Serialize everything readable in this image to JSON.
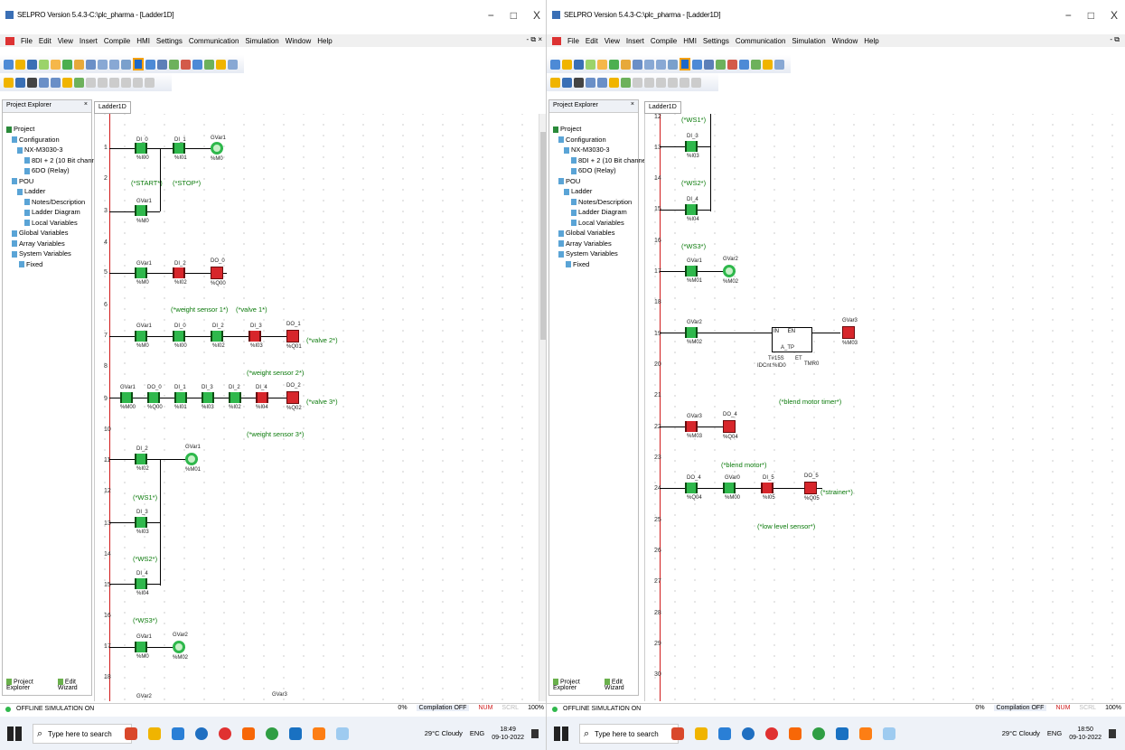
{
  "left": {
    "title": "SELPRO Version 5.4.3-C:\\plc_pharma - [Ladder1D]",
    "window_controls": [
      "−",
      "□",
      "X"
    ],
    "menu": [
      "File",
      "Edit",
      "View",
      "Insert",
      "Compile",
      "HMI",
      "Settings",
      "Communication",
      "Simulation",
      "Window",
      "Help"
    ],
    "mdi_controls": "- ⧉ ×",
    "explorer_title": "Project Explorer",
    "explorer_close": "×",
    "tree": [
      "Project",
      "Configuration",
      "NX-M3030-3",
      "8DI + 2 (10 Bit channel)",
      "6DO (Relay)",
      "POU",
      "Ladder",
      "Notes/Description",
      "Ladder Diagram",
      "Local Variables",
      "Global Variables",
      "Array Variables",
      "System Variables",
      "Fixed"
    ],
    "explorer_tabs": [
      "Project Explorer",
      "Edit Wizard"
    ],
    "doc_tab": "Ladder1D",
    "rungs": [
      "1",
      "2",
      "3",
      "4",
      "5",
      "6",
      "7",
      "8",
      "9",
      "10",
      "11",
      "12",
      "13",
      "14",
      "15",
      "16",
      "17",
      "18"
    ],
    "comments": {
      "start": "(*START*)",
      "stop": "(*STOP*)",
      "ws1_label": "(*weight sensor 1*)",
      "valve1": "(*valve 1*)",
      "valve2": "(*valve 2*)",
      "ws2_label": "(*weight sensor 2*)",
      "valve3": "(*valve 3*)",
      "ws3_label": "(*weight sensor 3*)",
      "ws1": "(*WS1*)",
      "ws2": "(*WS2*)",
      "ws3": "(*WS3*)"
    },
    "contacts": {
      "r1": [
        [
          "DI_0",
          "%I00"
        ],
        [
          "DI_1",
          "%I01"
        ]
      ],
      "r1coil": [
        "GVar1",
        "%M0"
      ],
      "r3": [
        "GVar1",
        "%M0"
      ],
      "r5": [
        [
          "GVar1",
          "%M0"
        ],
        [
          "DI_2",
          "%I02"
        ]
      ],
      "r5coil": [
        "DO_0",
        "%Q00"
      ],
      "r7": [
        [
          "GVar1",
          "%M0"
        ],
        [
          "DI_0",
          "%I00"
        ],
        [
          "DI_2",
          "%I02"
        ],
        [
          "DI_3",
          "%I03"
        ]
      ],
      "r7coil": [
        "DO_1",
        "%Q01"
      ],
      "r9": [
        [
          "GVar1",
          "%M00"
        ],
        [
          "DO_0",
          "%Q00"
        ],
        [
          "DI_1",
          "%I01"
        ],
        [
          "DI_3",
          "%I03"
        ],
        [
          "DI_2",
          "%I02"
        ],
        [
          "DI_4",
          "%I04"
        ]
      ],
      "r9coil": [
        "DO_2",
        "%Q02"
      ],
      "r11": [
        "DI_2",
        "%I02"
      ],
      "r11coil": [
        "GVar1",
        "%M01"
      ],
      "r13": [
        "DI_3",
        "%I03"
      ],
      "r15": [
        "DI_4",
        "%I04"
      ],
      "r17": [
        "GVar1",
        "%M0"
      ],
      "r17coil": [
        "GVar2",
        "%M02"
      ],
      "r19a": "GVar2",
      "r19b": "GVar3"
    },
    "status": {
      "mode": "OFFLINE SIMULATION ON",
      "pct": "0%",
      "compilation": "Compilation OFF",
      "num": "NUM",
      "scrl": "SCRL",
      "zoom": "100%"
    },
    "search_placeholder": "Type here to search",
    "weather": "29°C Cloudy",
    "lang": "ENG",
    "time": "18:49",
    "date": "09-10-2022"
  },
  "right": {
    "title": "SELPRO Version 5.4.3-C:\\plc_pharma - [Ladder1D]",
    "window_controls": [
      "−",
      "□",
      "X"
    ],
    "menu": [
      "File",
      "Edit",
      "View",
      "Insert",
      "Compile",
      "HMI",
      "Settings",
      "Communication",
      "Simulation",
      "Window",
      "Help"
    ],
    "mdi_controls": "- ⧉",
    "explorer_title": "Project Explorer",
    "explorer_close": "×",
    "tree": [
      "Project",
      "Configuration",
      "NX-M3030-3",
      "8DI + 2 (10 Bit channel)",
      "6DO (Relay)",
      "POU",
      "Ladder",
      "Notes/Description",
      "Ladder Diagram",
      "Local Variables",
      "Global Variables",
      "Array Variables",
      "System Variables",
      "Fixed"
    ],
    "explorer_tabs": [
      "Project Explorer",
      "Edit Wizard"
    ],
    "doc_tab": "Ladder1D",
    "rungs": [
      "12",
      "13",
      "14",
      "15",
      "16",
      "17",
      "18",
      "19",
      "20",
      "21",
      "22",
      "23",
      "24",
      "25",
      "26",
      "27",
      "28",
      "29",
      "30"
    ],
    "comments": {
      "ws1": "(*WS1*)",
      "ws2": "(*WS2*)",
      "ws3": "(*WS3*)",
      "blend_timer": "(*blend motor timer*)",
      "blend_motor": "(*blend motor*)",
      "strainer": "(*strainer*)",
      "low_level": "(*low level sensor*)"
    },
    "contacts": {
      "r13": [
        "DI_3",
        "%I03"
      ],
      "r15": [
        "DI_4",
        "%I04"
      ],
      "r17": [
        "GVar1",
        "%M01"
      ],
      "r17coil": [
        "GVar2",
        "%M02"
      ],
      "r19": [
        "GVar2",
        "%M02"
      ],
      "r19coil": [
        "GVar3",
        "%M03"
      ],
      "timer": [
        "IN",
        "EN",
        "TMR0",
        "PT",
        "ET",
        "A_TP",
        "T#15S",
        "IDCnt:%ID0"
      ],
      "r22": [
        "GVar3",
        "%M03"
      ],
      "r22coil": [
        "DO_4",
        "%Q04"
      ],
      "r24": [
        [
          "DO_4",
          "%Q04"
        ],
        [
          "GVar0",
          "%M00"
        ],
        [
          "DI_5",
          "%I05"
        ]
      ],
      "r24coil": [
        "DO_5",
        "%Q05"
      ]
    },
    "status": {
      "mode": "OFFLINE SIMULATION ON",
      "pct": "0%",
      "compilation": "Compilation OFF",
      "num": "NUM",
      "scrl": "SCRL",
      "zoom": "100%"
    },
    "search_placeholder": "Type here to search",
    "weather": "29°C Cloudy",
    "lang": "ENG",
    "time": "18:50",
    "date": "09-10-2022"
  },
  "colors": {
    "contact_on": "#2fb84c",
    "contact_off": "#d7262b",
    "rail": "#d01a1a",
    "comment": "#0a7a0a"
  }
}
